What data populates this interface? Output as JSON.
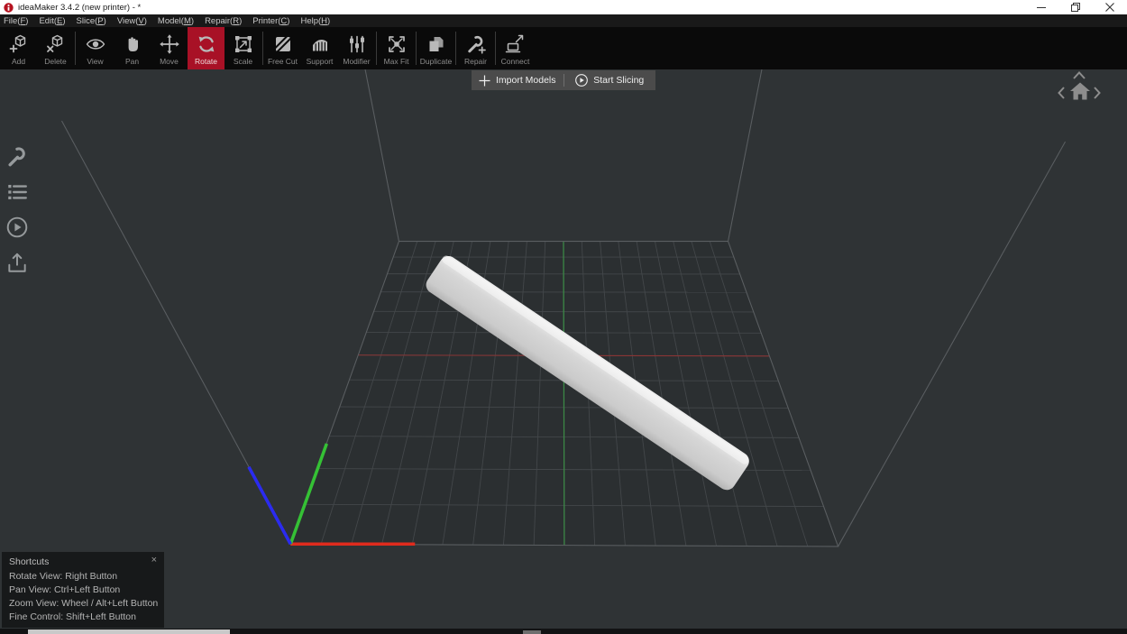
{
  "window": {
    "title": "ideaMaker 3.4.2 (new printer) - *",
    "app_icon": "ideamaker-logo",
    "controls": [
      "minimize",
      "restore",
      "close"
    ]
  },
  "menubar": {
    "items": [
      {
        "label": "File",
        "key": "F"
      },
      {
        "label": "Edit",
        "key": "E"
      },
      {
        "label": "Slice",
        "key": "P"
      },
      {
        "label": "View",
        "key": "V"
      },
      {
        "label": "Model",
        "key": "M"
      },
      {
        "label": "Repair",
        "key": "R"
      },
      {
        "label": "Printer",
        "key": "C"
      },
      {
        "label": "Help",
        "key": "H"
      }
    ]
  },
  "toolbar": {
    "active_tool": "Rotate",
    "active_color": "#a81126",
    "groups": [
      [
        {
          "label": "Add",
          "icon": "add-cube"
        },
        {
          "label": "Delete",
          "icon": "delete-cube"
        }
      ],
      [
        {
          "label": "View",
          "icon": "eye"
        },
        {
          "label": "Pan",
          "icon": "hand"
        },
        {
          "label": "Move",
          "icon": "move-arrows"
        },
        {
          "label": "Rotate",
          "icon": "rotate-arrows",
          "active": true
        },
        {
          "label": "Scale",
          "icon": "scale-box"
        }
      ],
      [
        {
          "label": "Free Cut",
          "icon": "free-cut"
        },
        {
          "label": "Support",
          "icon": "support"
        },
        {
          "label": "Modifier",
          "icon": "modifier-sliders"
        }
      ],
      [
        {
          "label": "Max Fit",
          "icon": "max-fit"
        }
      ],
      [
        {
          "label": "Duplicate",
          "icon": "duplicate-pages"
        }
      ],
      [
        {
          "label": "Repair",
          "icon": "repair-wrench"
        }
      ],
      [
        {
          "label": "Connect",
          "icon": "connect-device"
        }
      ]
    ]
  },
  "viewport": {
    "import_button": {
      "label": "Import Models",
      "icon": "plus"
    },
    "start_button": {
      "label": "Start Slicing",
      "icon": "play-circle"
    },
    "sidebar_tools": [
      {
        "name": "settings-wrench"
      },
      {
        "name": "model-list"
      },
      {
        "name": "preview-play"
      },
      {
        "name": "export-upload"
      }
    ],
    "view_nav": {
      "up": "chevron-up",
      "left": "chevron-left",
      "home": "home",
      "right": "chevron-right"
    },
    "shortcuts_panel": {
      "title": "Shortcuts",
      "close_glyph": "×",
      "lines": [
        "Rotate View: Right Button",
        "Pan View: Ctrl+Left Button",
        "Zoom View: Wheel / Alt+Left Button",
        "Fine Control: Shift+Left Button"
      ]
    },
    "axes": {
      "x_color": "#e02b1d",
      "y_color": "#35c135",
      "z_color": "#2b2bf0"
    },
    "scene": {
      "background": "#2f3335",
      "grid_color": "#43474a",
      "border_color": "#5a5e61",
      "center_line_x_color": "#8a3535",
      "center_line_y_color": "#3c8a46",
      "model_color": "#d6d6d6",
      "model_count": 1
    }
  }
}
